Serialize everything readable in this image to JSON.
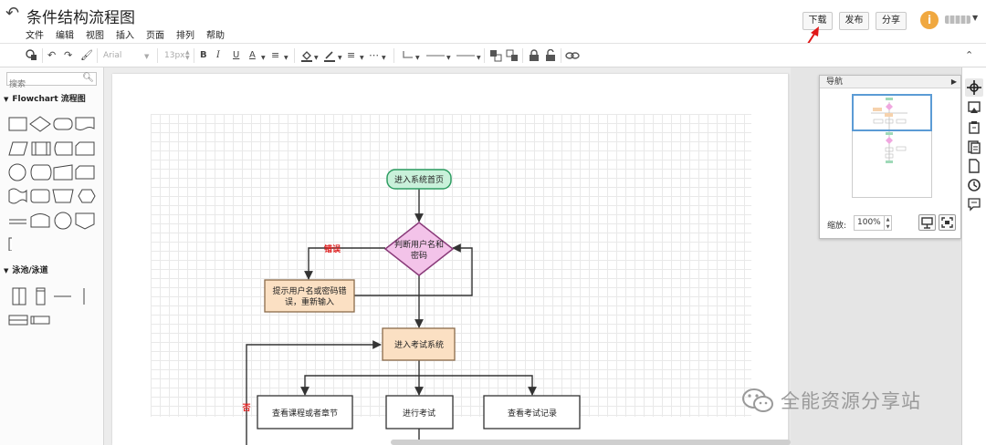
{
  "app": {
    "title": "条件结构流程图",
    "menus": [
      "文件",
      "编辑",
      "视图",
      "插入",
      "页面",
      "排列",
      "帮助"
    ],
    "buttons": {
      "download": "下载",
      "publish": "发布",
      "share": "分享"
    },
    "avatar_letter": "i"
  },
  "toolbar": {
    "font": "Arial",
    "size": "13px",
    "bold": "B",
    "italic": "I",
    "underline": "U",
    "font_color": "A"
  },
  "sidebar": {
    "search_placeholder": "搜索",
    "sections": [
      {
        "label": "Flowchart 流程图"
      },
      {
        "label": "泳池/泳道"
      }
    ]
  },
  "diagram": {
    "nodes": {
      "start": "进入系统首页",
      "decision": [
        "判断用户名和",
        "密码"
      ],
      "error_box": [
        "提示用户名或密码错",
        "误，重新输入"
      ],
      "enter_exam": "进入考试系统",
      "view_course": "查看课程或者章节",
      "take_exam": "进行考试",
      "view_record": "查看考试记录"
    },
    "labels": {
      "error": "错误",
      "no": "否"
    },
    "colors": {
      "start_fill": "#c9f1da",
      "start_stroke": "#2e9d62",
      "decision_fill": "#f3c3e9",
      "decision_stroke": "#8a3b7a",
      "process_fill": "#fbe0c3",
      "process_stroke": "#8a6b4a",
      "label_red": "#e02020"
    }
  },
  "navigator": {
    "title": "导航",
    "zoom_label": "缩放:",
    "zoom_value": "100%"
  },
  "watermark": "全能资源分享站"
}
